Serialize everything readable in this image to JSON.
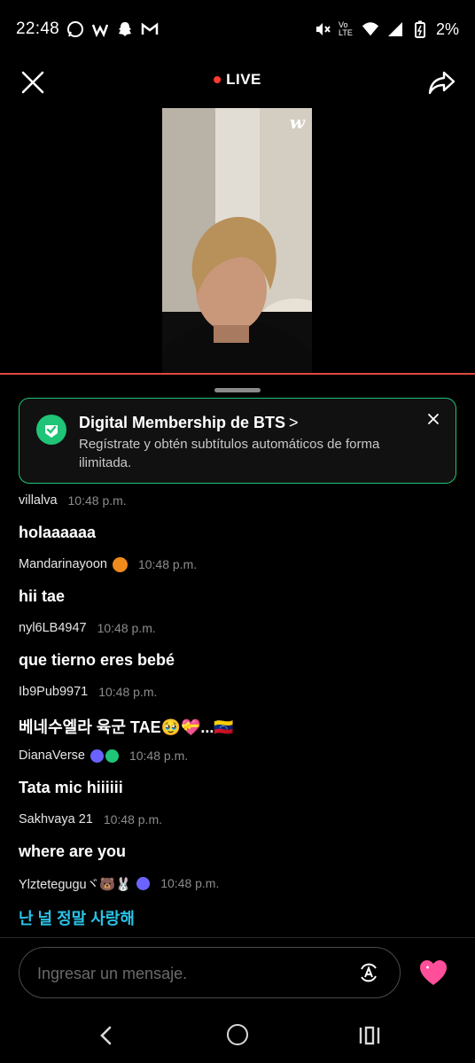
{
  "status_bar": {
    "time": "22:48",
    "battery": "2%",
    "network": "Vo LTE"
  },
  "top_bar": {
    "live_label": "LIVE"
  },
  "video": {
    "watermark": "w"
  },
  "banner": {
    "title": "Digital Membership de BTS",
    "chevron": ">",
    "description": "Regístrate y obtén subtítulos automáticos de forma ilimitada."
  },
  "chat": {
    "messages": [
      {
        "user": "villalva",
        "time": "10:48 p.m.",
        "text": "holaaaaaa"
      },
      {
        "user": "Mandarinayoon",
        "time": "10:48 p.m.",
        "text": "hii tae"
      },
      {
        "user": "nyl6LB4947",
        "time": "10:48 p.m.",
        "text": "que tierno eres bebé"
      },
      {
        "user": "Ib9Pub9971",
        "time": "10:48 p.m.",
        "text": "베네수엘라 육군 TAE🥹💝...🇻🇪"
      },
      {
        "user": "DianaVerse",
        "time": "10:48 p.m.",
        "text": "Tata mic hiiiiii"
      },
      {
        "user": "Sakhvaya 21",
        "time": "10:48 p.m.",
        "text": "where are you"
      },
      {
        "user": "Ylzteteguguヾ🐻🐰",
        "time": "10:48 p.m.",
        "text": "난 널 정말 사랑해"
      }
    ]
  },
  "input": {
    "placeholder": "Ingresar un mensaje."
  },
  "colors": {
    "accent_green": "#1fc477",
    "live_red": "#ff3b2f",
    "highlight_cyan": "#29c3e8",
    "heart_pink": "#ff4f9a"
  },
  "icons": [
    "whatsapp-icon",
    "weverse-icon",
    "snapchat-icon",
    "gmail-icon",
    "mute-icon",
    "wifi-icon",
    "signal-icon",
    "battery-icon",
    "close-icon",
    "share-icon",
    "membership-check-icon",
    "translate-icon",
    "heart-icon",
    "nav-back-icon",
    "nav-home-icon",
    "nav-recent-icon"
  ]
}
